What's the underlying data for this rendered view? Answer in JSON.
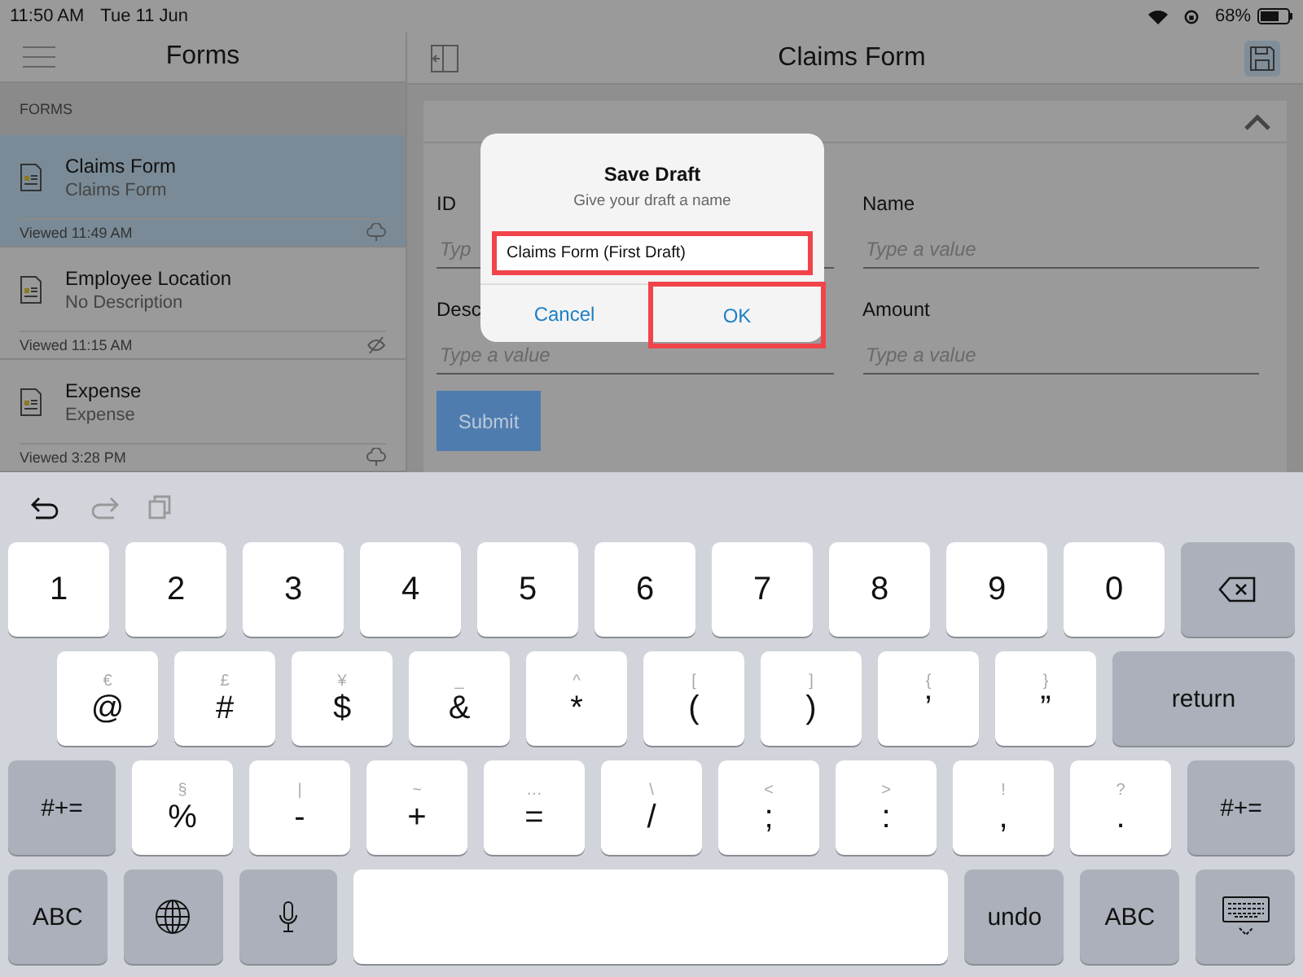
{
  "status_bar": {
    "time": "11:50 AM",
    "date": "Tue 11 Jun",
    "battery": "68%"
  },
  "sidebar": {
    "title": "Forms",
    "section": "FORMS",
    "items": [
      {
        "title": "Claims Form",
        "subtitle": "Claims Form",
        "viewed": "Viewed 11:49 AM",
        "kind": "cloud",
        "selected": true
      },
      {
        "title": "Employee Location",
        "subtitle": "No Description",
        "viewed": "Viewed 11:15 AM",
        "kind": "hidden",
        "selected": false
      },
      {
        "title": "Expense",
        "subtitle": "Expense",
        "viewed": "Viewed 3:28 PM",
        "kind": "cloud",
        "selected": false
      }
    ]
  },
  "main": {
    "title": "Claims Form",
    "expanded": true,
    "fields": [
      {
        "label": "ID",
        "placeholder": "Typ"
      },
      {
        "label": "Name",
        "placeholder": "Type a value"
      },
      {
        "label": "Desc",
        "placeholder": "Type a value"
      },
      {
        "label": "Amount",
        "placeholder": "Type a value"
      }
    ],
    "submit": "Submit"
  },
  "dialog": {
    "title": "Save Draft",
    "message": "Give your draft a name",
    "value": "Claims Form (First Draft)",
    "value_highlighted": true,
    "buttons": [
      {
        "label": "Cancel",
        "highlighted": false
      },
      {
        "label": "OK",
        "highlighted": true
      }
    ]
  },
  "keyboard": {
    "rows": [
      {
        "keys": [
          {
            "kind": "char",
            "label": "1"
          },
          {
            "kind": "char",
            "label": "2"
          },
          {
            "kind": "char",
            "label": "3"
          },
          {
            "kind": "char",
            "label": "4"
          },
          {
            "kind": "char",
            "label": "5"
          },
          {
            "kind": "char",
            "label": "6"
          },
          {
            "kind": "char",
            "label": "7"
          },
          {
            "kind": "char",
            "label": "8"
          },
          {
            "kind": "char",
            "label": "9"
          },
          {
            "kind": "char",
            "label": "0"
          },
          {
            "kind": "delete"
          }
        ]
      },
      {
        "keys": [
          {
            "kind": "char",
            "label": "@",
            "alt": "€"
          },
          {
            "kind": "char",
            "label": "#",
            "alt": "£"
          },
          {
            "kind": "char",
            "label": "$",
            "alt": "¥"
          },
          {
            "kind": "char",
            "label": "&",
            "alt": "_"
          },
          {
            "kind": "char",
            "label": "*",
            "alt": "^"
          },
          {
            "kind": "char",
            "label": "(",
            "alt": "["
          },
          {
            "kind": "char",
            "label": ")",
            "alt": "]"
          },
          {
            "kind": "char",
            "label": "’",
            "alt": "{"
          },
          {
            "kind": "char",
            "label": "”",
            "alt": "}"
          },
          {
            "kind": "function",
            "label": "return"
          }
        ]
      },
      {
        "keys": [
          {
            "kind": "function",
            "label": "#+="
          },
          {
            "kind": "char",
            "label": "%",
            "alt": "§"
          },
          {
            "kind": "char",
            "label": "-",
            "alt": "|"
          },
          {
            "kind": "char",
            "label": "+",
            "alt": "~"
          },
          {
            "kind": "char",
            "label": "=",
            "alt": "…"
          },
          {
            "kind": "char",
            "label": "/",
            "alt": "\\"
          },
          {
            "kind": "char",
            "label": ";",
            "alt": "<"
          },
          {
            "kind": "char",
            "label": ":",
            "alt": ">"
          },
          {
            "kind": "char",
            "label": ",",
            "alt": "!"
          },
          {
            "kind": "char",
            "label": ".",
            "alt": "?"
          },
          {
            "kind": "function",
            "label": "#+="
          }
        ]
      },
      {
        "keys": [
          {
            "kind": "function",
            "label": "ABC"
          },
          {
            "kind": "globe"
          },
          {
            "kind": "mic"
          },
          {
            "kind": "space"
          },
          {
            "kind": "function",
            "label": "undo"
          },
          {
            "kind": "function",
            "label": "ABC"
          },
          {
            "kind": "hide"
          }
        ]
      }
    ]
  }
}
